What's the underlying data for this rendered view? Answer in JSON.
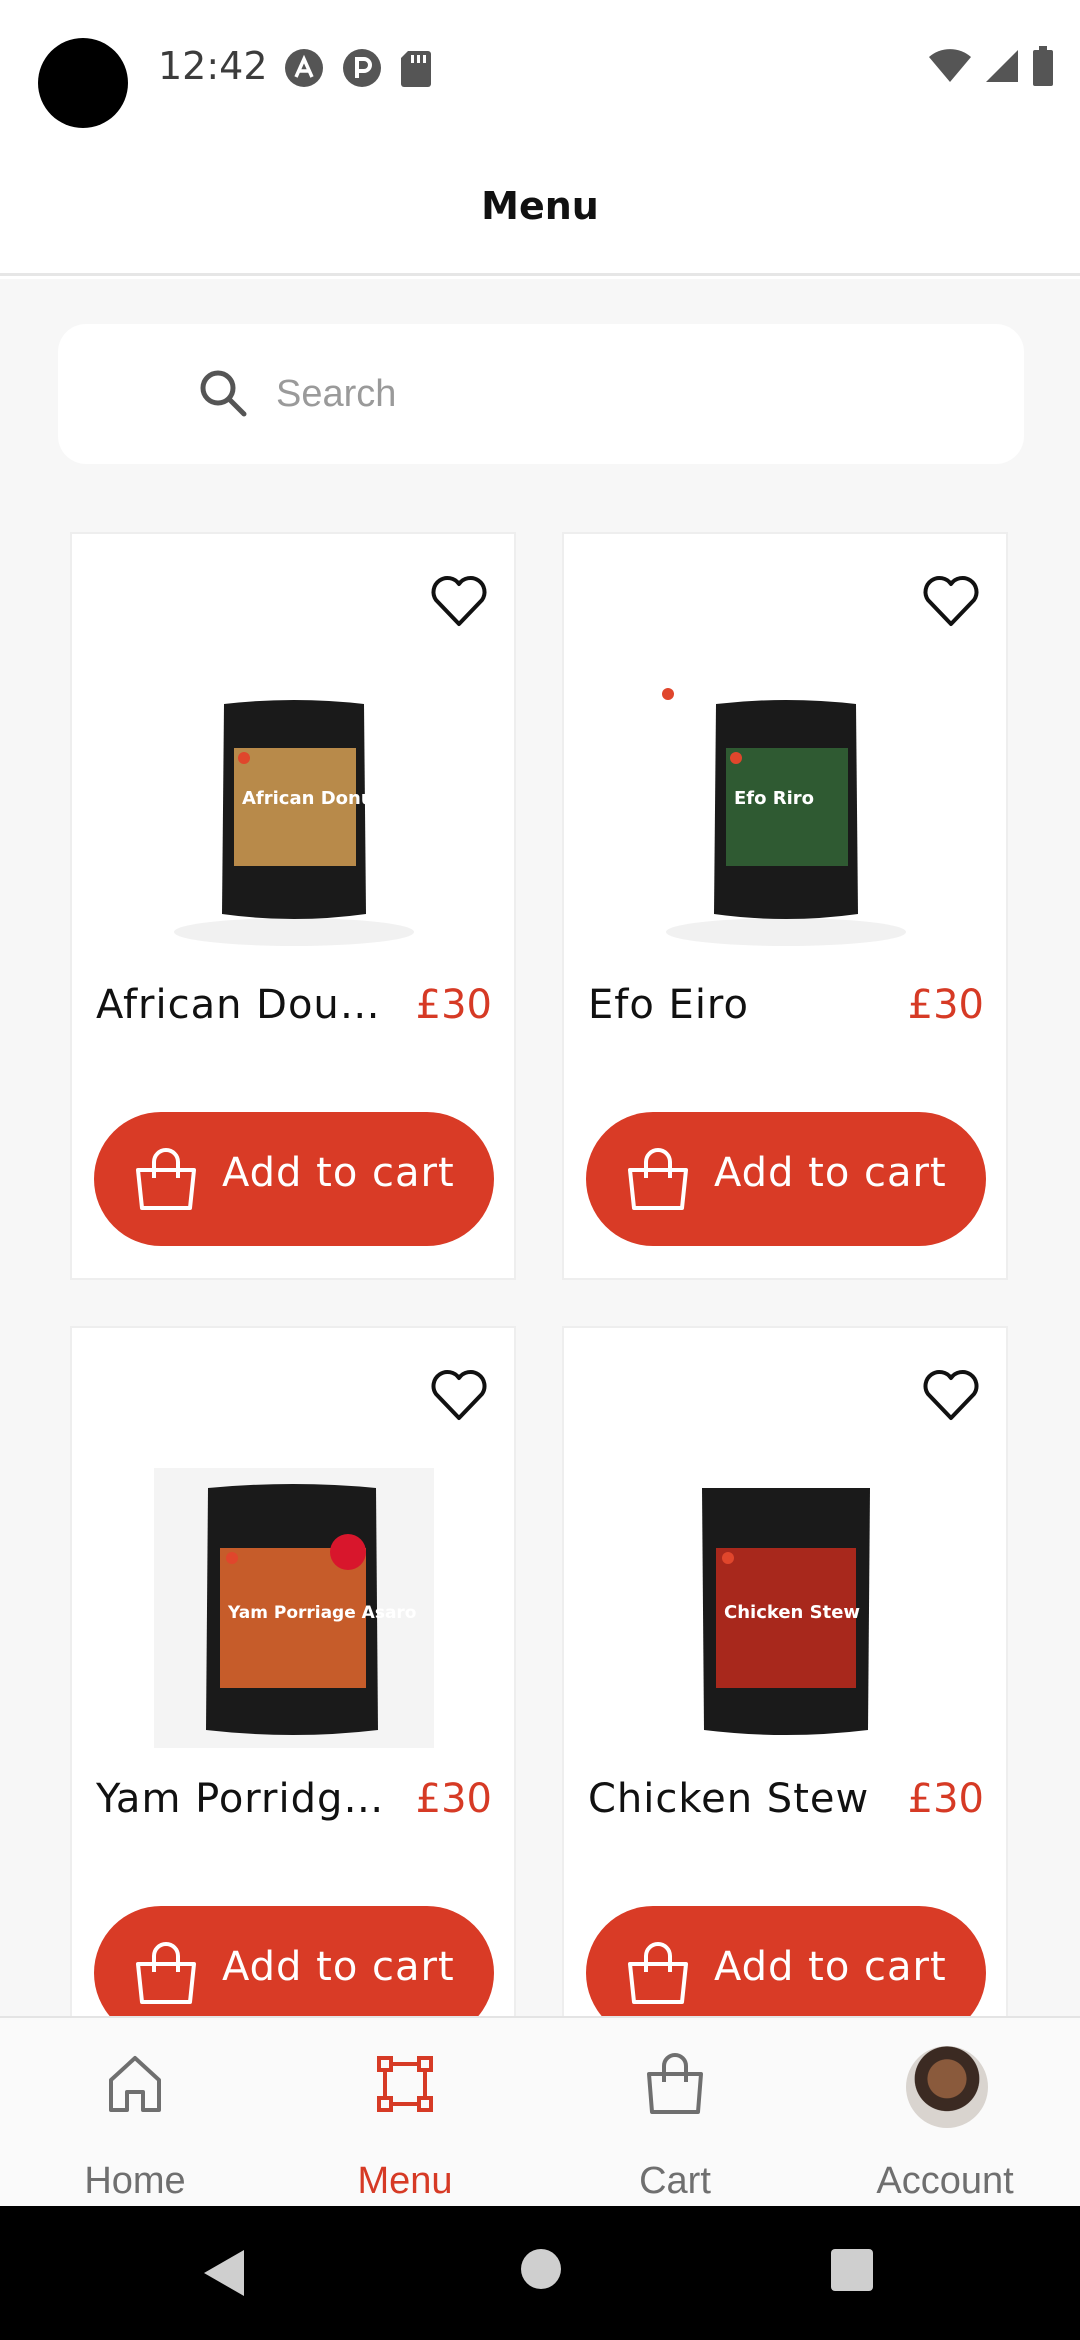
{
  "status_bar": {
    "time": "12:42",
    "icons_left": [
      "a-icon",
      "p-icon",
      "sd-card-icon"
    ],
    "icons_right": [
      "wifi-icon",
      "signal-icon",
      "battery-icon"
    ]
  },
  "header": {
    "title": "Menu"
  },
  "search": {
    "placeholder": "Search"
  },
  "products": [
    {
      "name": "African Doughnut Mix",
      "price": "£30",
      "button": "Add to cart",
      "pack_label": "African Donut Mix",
      "pack_color": "#b88a4a"
    },
    {
      "name": "Efo Eiro",
      "price": "£30",
      "button": "Add to cart",
      "pack_label": "Efo Riro",
      "pack_color": "#2f5a32"
    },
    {
      "name": "Yam Porridge Asaro",
      "price": "£30",
      "button": "Add to cart",
      "pack_label": "Yam Porriage Asaro",
      "pack_color": "#c65c2a"
    },
    {
      "name": "Chicken Stew",
      "price": "£30",
      "button": "Add to cart",
      "pack_label": "Chicken Stew",
      "pack_color": "#a8281c"
    }
  ],
  "brand_colors": {
    "accent": "#d93b26",
    "price": "#d63a25"
  },
  "bottom_nav": [
    {
      "label": "Home",
      "icon": "home-icon",
      "active": false
    },
    {
      "label": "Menu",
      "icon": "menu-frame-icon",
      "active": true
    },
    {
      "label": "Cart",
      "icon": "bag-icon",
      "active": false
    },
    {
      "label": "Account",
      "icon": "avatar",
      "active": false
    }
  ]
}
